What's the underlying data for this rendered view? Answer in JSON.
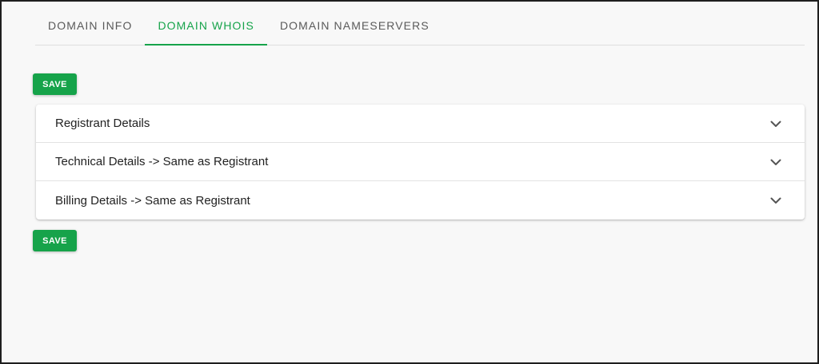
{
  "tabs": [
    {
      "label": "DOMAIN INFO",
      "active": false
    },
    {
      "label": "DOMAIN WHOIS",
      "active": true
    },
    {
      "label": "DOMAIN NAMESERVERS",
      "active": false
    }
  ],
  "actions": {
    "save_top_label": "SAVE",
    "save_bottom_label": "SAVE"
  },
  "panels": [
    {
      "title": "Registrant Details",
      "icon": "chevron-down-icon"
    },
    {
      "title": "Technical Details -> Same as Registrant",
      "icon": "chevron-down-icon"
    },
    {
      "title": "Billing Details -> Same as Registrant",
      "icon": "chevron-down-icon"
    }
  ],
  "colors": {
    "accent": "#16a34a",
    "background": "#f8f8f8",
    "tab_inactive": "#5a5a5a",
    "panel_text": "#222222"
  }
}
